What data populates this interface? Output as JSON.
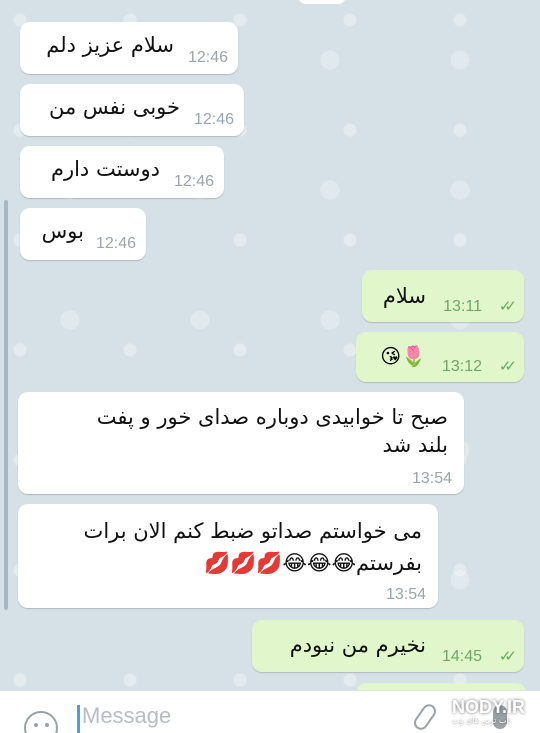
{
  "messages": [
    {
      "direction": "incoming",
      "text": "سلام عزیز دلم",
      "time": "12:46"
    },
    {
      "direction": "incoming",
      "text": "خوبی نفس من",
      "time": "12:46"
    },
    {
      "direction": "incoming",
      "text": "دوستت دارم",
      "time": "12:46"
    },
    {
      "direction": "incoming",
      "text": "بوس",
      "time": "12:46"
    },
    {
      "direction": "outgoing",
      "text": "سلام",
      "time": "13:11",
      "status": "read"
    },
    {
      "direction": "outgoing",
      "text": "😘🌷",
      "time": "13:12",
      "status": "read"
    },
    {
      "direction": "incoming",
      "lines": [
        "صبح تا خوابیدی دوباره صدای خور و پفت",
        "بلند شد"
      ],
      "time": "13:54"
    },
    {
      "direction": "incoming",
      "lines": [
        "می خواستم صداتو ضبط کنم الان برات",
        "بفرستم😂😂😂💋💋💋"
      ],
      "time": "13:54"
    },
    {
      "direction": "outgoing",
      "text": "نخیرم من نبودم",
      "time": "14:45",
      "status": "read"
    }
  ],
  "composer": {
    "placeholder": "Message"
  },
  "icons": {
    "emoji": "smile-icon",
    "attach": "paperclip-icon",
    "voice": "microphone-icon",
    "read": "double-check-icon"
  },
  "watermark": {
    "text": "NODY.IR",
    "subtext": "ناب ترین های وب"
  },
  "colors": {
    "incoming_bubble": "#ffffff",
    "outgoing_bubble": "#e1f7cb",
    "check": "#5fae5a"
  }
}
